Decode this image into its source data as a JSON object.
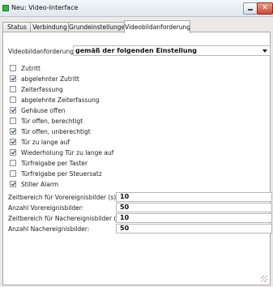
{
  "window": {
    "title": "Neu: Video-Interface",
    "close_glyph": "✕"
  },
  "tabs": [
    {
      "label": "Status",
      "active": false
    },
    {
      "label": "Verbindung",
      "active": false
    },
    {
      "label": "Grundeinstellungen",
      "active": false
    },
    {
      "label": "Videobildanforderung",
      "active": true
    }
  ],
  "form": {
    "request_label": "Videobildanforderung:",
    "request_value": "gemäß der folgenden Einstellung",
    "checkboxes": [
      {
        "label": "Zutritt",
        "checked": false
      },
      {
        "label": "abgelehnter Zutritt",
        "checked": true
      },
      {
        "label": "Zeiterfassung",
        "checked": false
      },
      {
        "label": "abgelehnte Zeiterfassung",
        "checked": false
      },
      {
        "label": "Gehäuse offen",
        "checked": true
      },
      {
        "label": "Tür offen, berechtigt",
        "checked": false
      },
      {
        "label": "Tür offen, unberechtigt",
        "checked": true
      },
      {
        "label": "Tür zu lange auf",
        "checked": true
      },
      {
        "label": "Wiederholung Tür zu lange auf",
        "checked": true
      },
      {
        "label": "Türfreigabe per Taster",
        "checked": false
      },
      {
        "label": "Türfreigabe per Steuersatz",
        "checked": false
      },
      {
        "label": "Stiller Alarm",
        "checked": true
      }
    ],
    "numbers": [
      {
        "label": "Zeitbereich für Vorereignisbilder (s):",
        "value": "10"
      },
      {
        "label": "Anzahl Vorereignisbilder:",
        "value": "50"
      },
      {
        "label": "Zeitbereich für Nachereignisbilder (s):",
        "value": "10"
      },
      {
        "label": "Anzahl Nachereignisbilder:",
        "value": "50"
      }
    ]
  }
}
